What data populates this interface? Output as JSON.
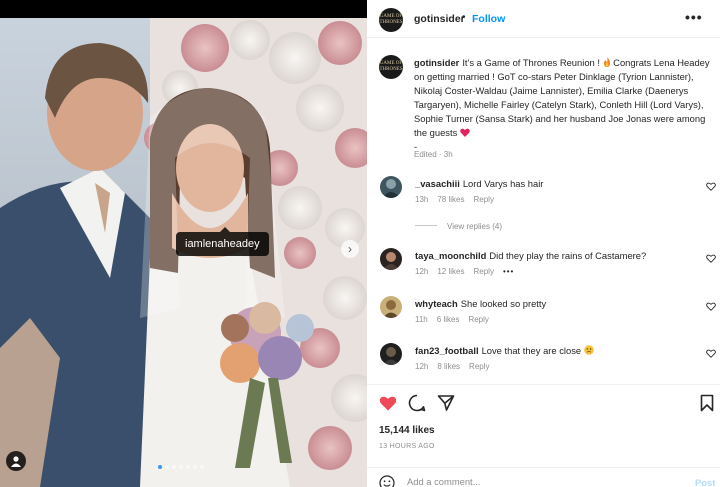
{
  "post": {
    "username": "gotinsider",
    "avatar_text": "GAME OF THRONES",
    "follow_label": "Follow",
    "separator": "•",
    "more_label": "•••",
    "photo_tag": "iamlenaheadey",
    "carousel": {
      "count": 7,
      "active": 0
    },
    "caption_username": "gotinsider",
    "caption_part1": "It's a Game of Thrones Reunion ! ",
    "caption_part2": " Congrats Lena Headey on getting married ! GoT co-stars Peter Dinklage (Tyrion Lannister), Nikolaj Coster-Waldau (Jaime Lannister), Emilia Clarke (Daenerys Targaryen), Michelle Fairley (Catelyn Stark), Conleth Hill (Lord Varys), Sophie Turner (Sansa Stark) and her husband Joe Jonas were among the guests ",
    "caption_trail": "-",
    "edited": "Edited · 3h",
    "likes": "15,144 likes",
    "time_ago": "13 HOURS AGO",
    "add_comment_placeholder": "Add a comment...",
    "post_label": "Post"
  },
  "comments": [
    {
      "username": "_vasachiii",
      "text": "Lord Varys has hair",
      "time": "13h",
      "likes": "78 likes",
      "reply": "Reply",
      "more": ""
    },
    {
      "username": "taya_moonchild",
      "text": "Did they play the rains of Castamere?",
      "time": "12h",
      "likes": "12 likes",
      "reply": "Reply",
      "more": "•••"
    },
    {
      "username": "whyteach",
      "text": "She looked so pretty",
      "time": "11h",
      "likes": "6 likes",
      "reply": "Reply",
      "more": ""
    },
    {
      "username": "fan23_football",
      "text": "Love that they are close",
      "time": "12h",
      "likes": "8 likes",
      "reply": "Reply",
      "more": ""
    }
  ],
  "view_replies": "View replies (4)",
  "colors": {
    "link": "#0095f6",
    "like_red": "#ed4956",
    "text": "#262626",
    "muted": "#8e8e8e"
  }
}
